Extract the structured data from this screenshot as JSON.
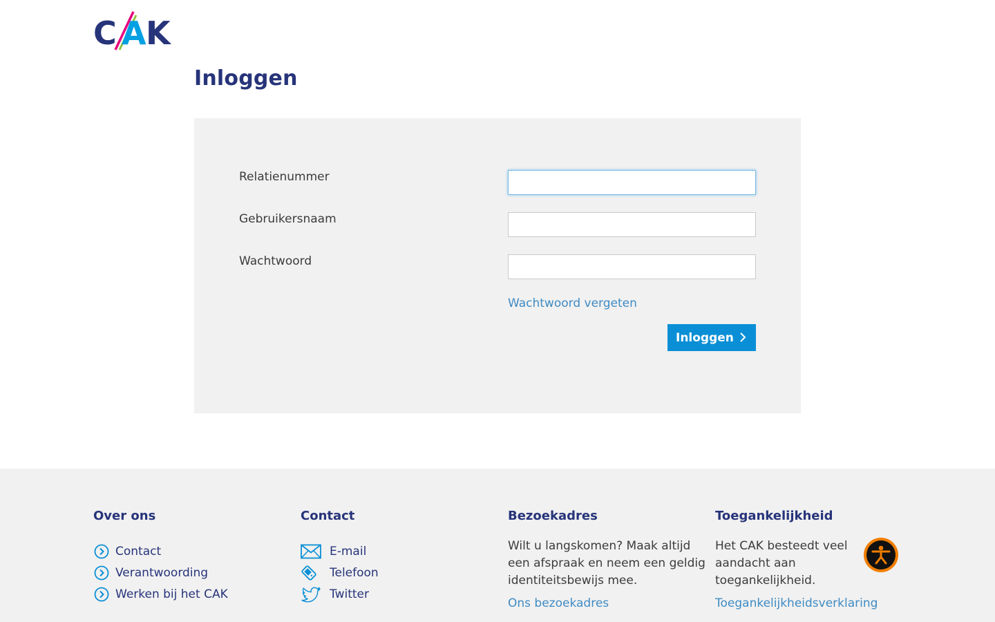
{
  "brand": {
    "logo_text": "CAK",
    "primary_color": "#27347a",
    "accent_color": "#0a8fd6",
    "logo_pink": "#e6007e",
    "logo_green": "#8cc63f",
    "logo_light_blue": "#00a0e3"
  },
  "page": {
    "title": "Inloggen"
  },
  "login_form": {
    "fields": [
      {
        "label": "Relatienummer",
        "value": "",
        "focused": true
      },
      {
        "label": "Gebruikersnaam",
        "value": ""
      },
      {
        "label": "Wachtwoord",
        "value": ""
      }
    ],
    "forgot_link": "Wachtwoord vergeten",
    "submit_label": "Inloggen",
    "submit_icon": "chevron-right-icon"
  },
  "footer": {
    "over_ons": {
      "heading": "Over ons",
      "items": [
        {
          "label": "Contact",
          "icon": "circle-chevron-right-icon"
        },
        {
          "label": "Verantwoording",
          "icon": "circle-chevron-right-icon"
        },
        {
          "label": "Werken bij het CAK",
          "icon": "circle-chevron-right-icon"
        }
      ]
    },
    "contact": {
      "heading": "Contact",
      "items": [
        {
          "label": "E-mail",
          "icon": "envelope-icon"
        },
        {
          "label": "Telefoon",
          "icon": "phone-icon"
        },
        {
          "label": "Twitter",
          "icon": "twitter-icon"
        }
      ]
    },
    "bezoekadres": {
      "heading": "Bezoekadres",
      "text": "Wilt u langskomen? Maak altijd een afspraak en neem een geldig identiteitsbewijs mee.",
      "link": "Ons bezoekadres"
    },
    "toegankelijkheid": {
      "heading": "Toegankelijkheid",
      "text": "Het CAK besteedt veel aandacht aan toegankelijkheid.",
      "link": "Toegankelijkheidsverklaring"
    }
  },
  "accessibility_widget": {
    "icon": "accessibility-person-icon",
    "ring_color": "#f07e00"
  }
}
